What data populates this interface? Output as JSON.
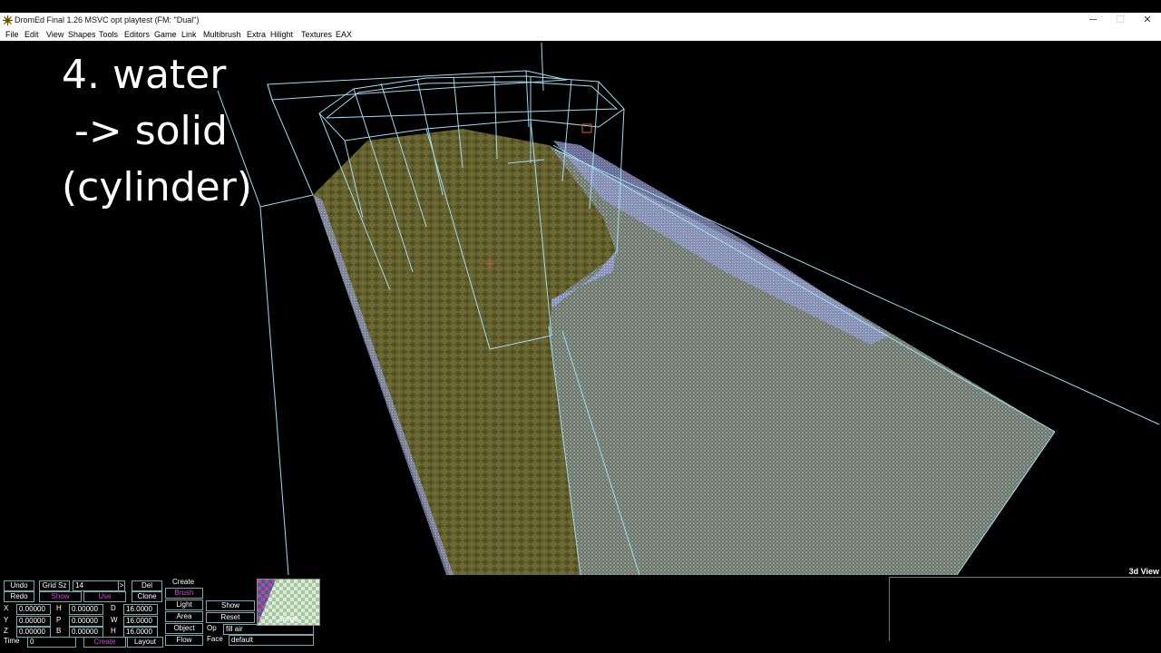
{
  "window": {
    "title": "DromEd Final 1.26 MSVC opt playtest (FM: \"Dual\")",
    "min_glyph": "─",
    "max_glyph": "☐",
    "close_glyph": "✕"
  },
  "menu": [
    "File",
    "Edit",
    "View",
    "Shapes",
    "Tools",
    "Editors",
    "Game",
    "Link",
    "Multibrush",
    "Extra",
    "Hilight",
    "Textures",
    "EAX"
  ],
  "overlay_text": "4. water\n -> solid\n(cylinder)",
  "view_label": "3d View",
  "panel": {
    "undo": "Undo",
    "redo": "Redo",
    "grid_label": "Grid Sz",
    "grid_value": "14",
    "show": "Show",
    "use": "Use",
    "del": "Del",
    "clone": "Clone",
    "create": "Create",
    "brush": "Brush",
    "light": "Light",
    "area": "Area",
    "object": "Object",
    "flow": "Flow",
    "show2": "Show",
    "reset": "Reset",
    "op_label": "Op",
    "op_value": "fill air",
    "face_label": "Face",
    "face_value": "default",
    "time_label": "Time",
    "time_value": "0",
    "create2": "Create",
    "layout": "Layout",
    "texture_name": "Jorge",
    "rows": [
      {
        "a": "X",
        "av": "0.00000",
        "b": "H",
        "bv": "0.00000",
        "c": "D",
        "cv": "16.0000"
      },
      {
        "a": "Y",
        "av": "0.00000",
        "b": "P",
        "bv": "0.00000",
        "c": "W",
        "cv": "16.0000"
      },
      {
        "a": "Z",
        "av": "0.00000",
        "b": "B",
        "bv": "0.00000",
        "c": "H",
        "cv": "16.0000"
      }
    ]
  }
}
